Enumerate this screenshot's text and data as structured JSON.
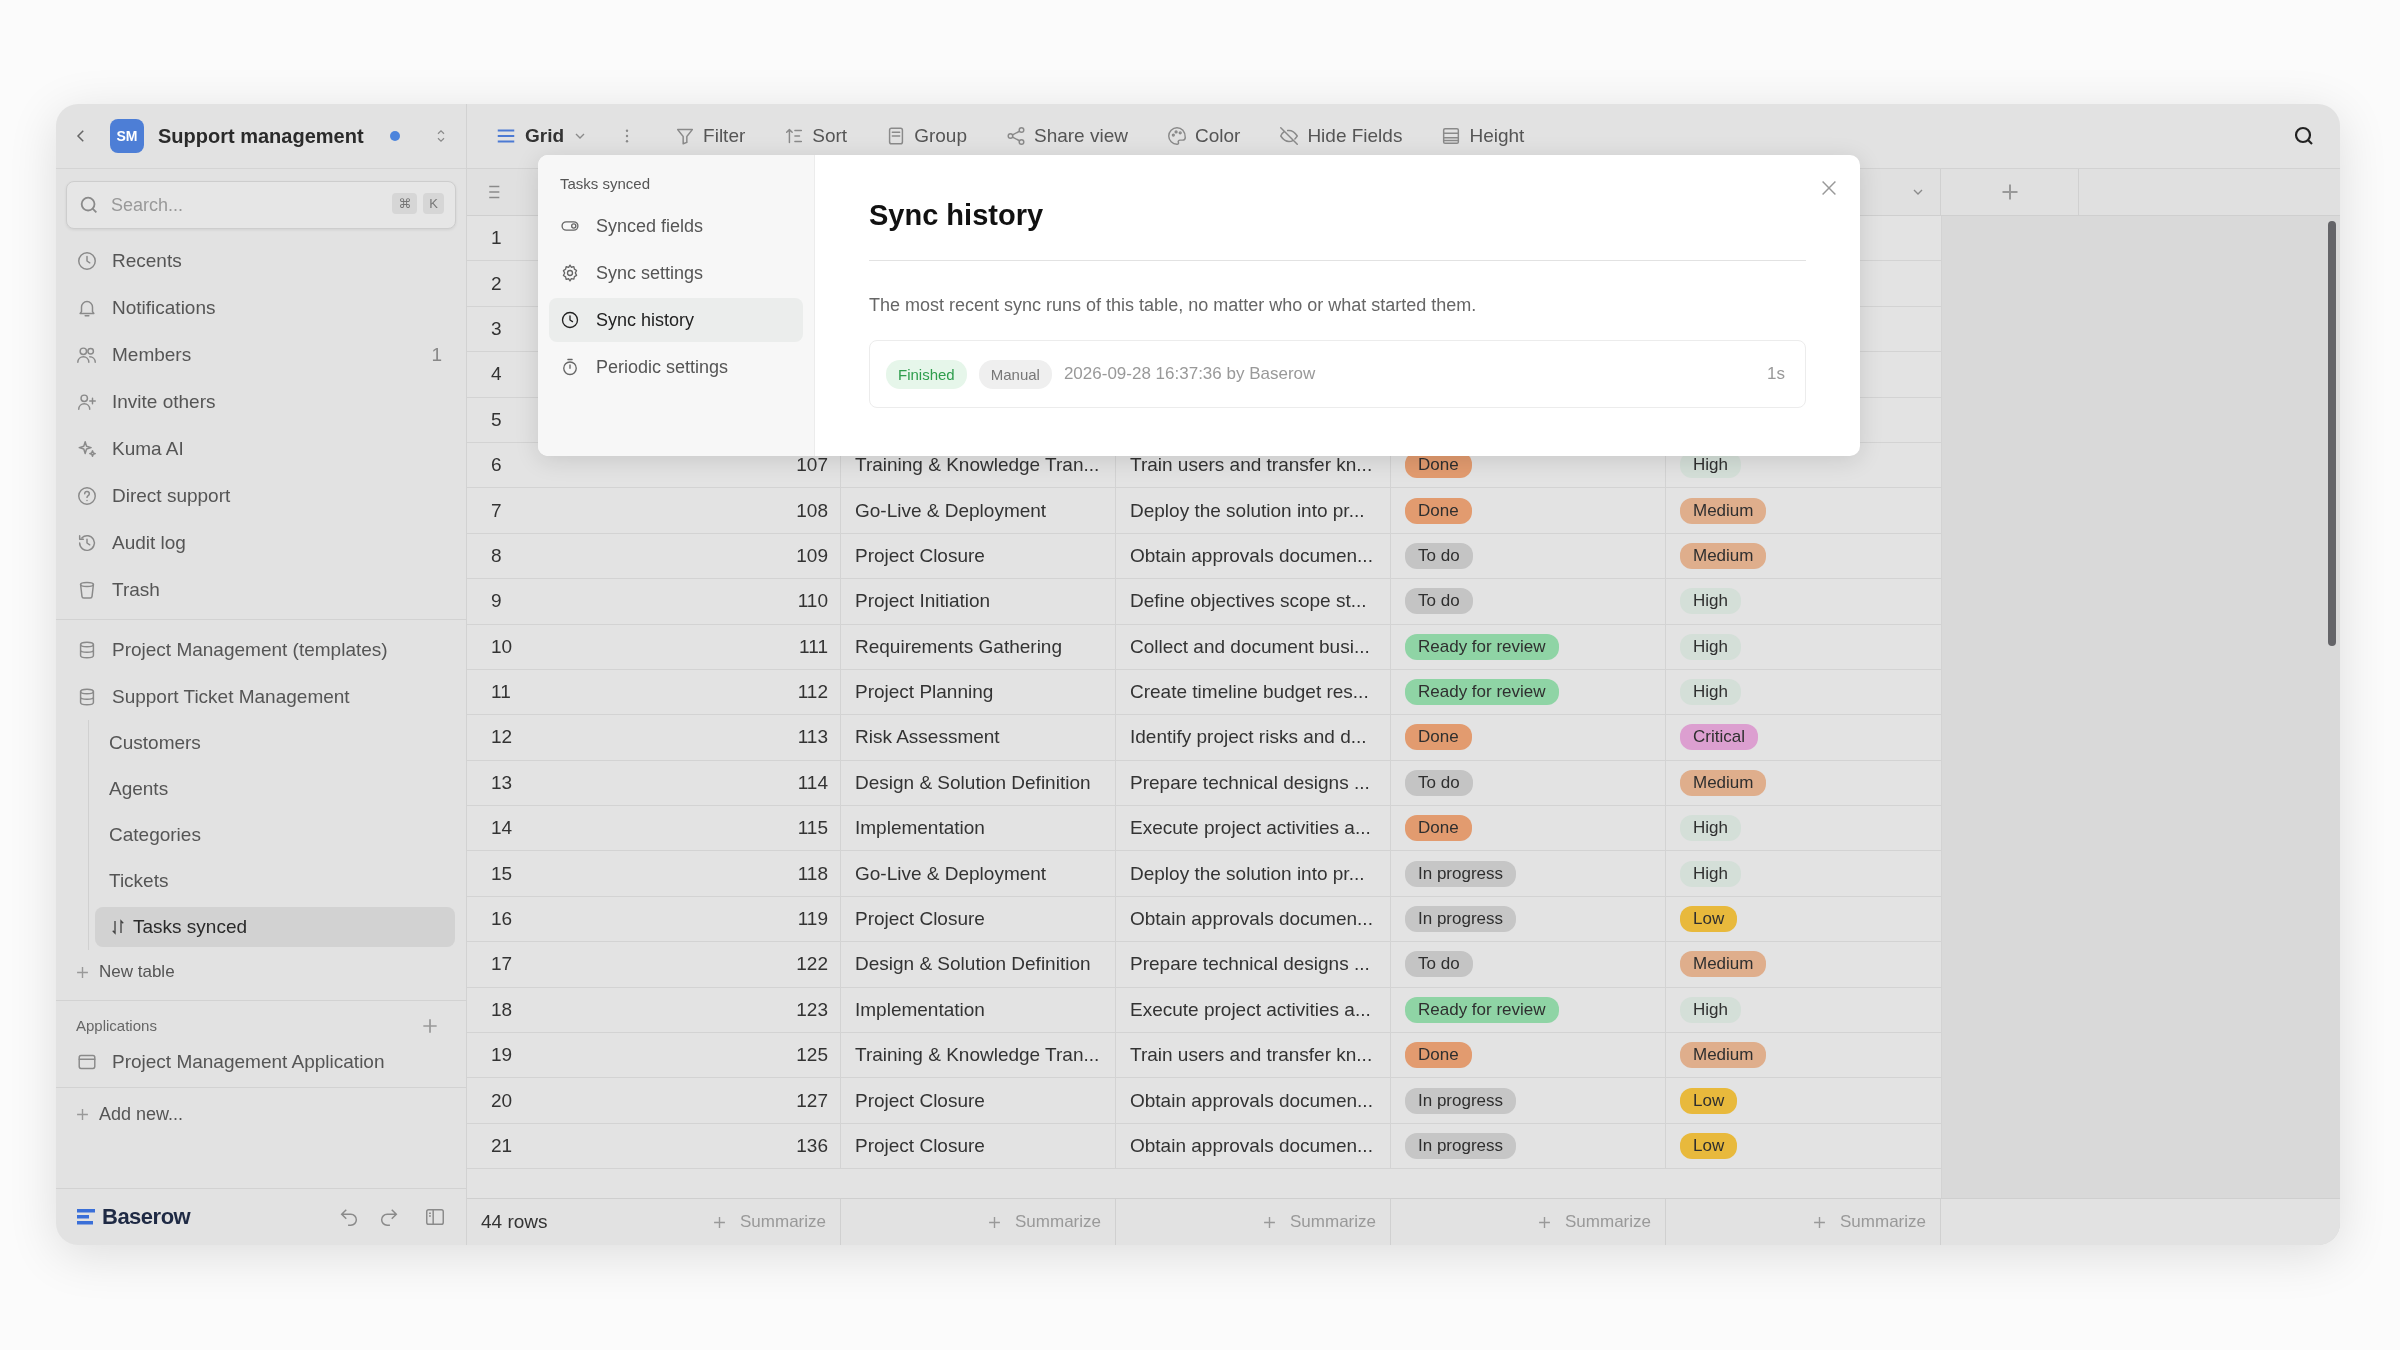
{
  "workspace": {
    "initials": "SM",
    "name": "Support management",
    "unread": true
  },
  "sidebar": {
    "search": {
      "placeholder": "Search...",
      "keys": [
        "⌘",
        "K"
      ]
    },
    "nav": [
      {
        "label": "Recents",
        "kind": "clock"
      },
      {
        "label": "Notifications",
        "kind": "bell"
      },
      {
        "label": "Members",
        "kind": "users",
        "count": "1"
      },
      {
        "label": "Invite others",
        "kind": "user-plus"
      },
      {
        "label": "Kuma AI",
        "kind": "sparkle"
      },
      {
        "label": "Direct support",
        "kind": "help"
      },
      {
        "label": "Audit log",
        "kind": "history"
      },
      {
        "label": "Trash",
        "kind": "trash"
      }
    ],
    "databases": [
      {
        "name": "Project Management (templates)"
      },
      {
        "name": "Support Ticket Management",
        "tables": [
          {
            "name": "Customers",
            "selected": false,
            "synced": false
          },
          {
            "name": "Agents",
            "selected": false,
            "synced": false
          },
          {
            "name": "Categories",
            "selected": false,
            "synced": false
          },
          {
            "name": "Tickets",
            "selected": false,
            "synced": false
          },
          {
            "name": "Tasks synced",
            "selected": true,
            "synced": true
          }
        ]
      }
    ],
    "new_table": "New table",
    "applications_heading": "Applications",
    "applications": [
      "Project Management Application"
    ],
    "add_new": "Add new...",
    "logo": "Baserow"
  },
  "toolbar": {
    "view": "Grid",
    "items": [
      {
        "label": "Filter",
        "kind": "filter"
      },
      {
        "label": "Sort",
        "kind": "sort"
      },
      {
        "label": "Group",
        "kind": "group"
      },
      {
        "label": "Share view",
        "kind": "share"
      },
      {
        "label": "Color",
        "kind": "palette"
      },
      {
        "label": "Hide Fields",
        "kind": "eye-off"
      },
      {
        "label": "Height",
        "kind": "rows"
      }
    ]
  },
  "grid": {
    "rows": [
      {
        "number": "1"
      },
      {
        "number": "2"
      },
      {
        "number": "3"
      },
      {
        "number": "4"
      },
      {
        "number": "5"
      },
      {
        "number": "6",
        "id": "107",
        "name": "Training & Knowledge Tran...",
        "description": "Train users and transfer kn...",
        "status": {
          "label": "Done",
          "color": "#e29b6f"
        },
        "priority": {
          "label": "High",
          "color": "#d4dfd8"
        }
      },
      {
        "number": "7",
        "id": "108",
        "name": "Go-Live & Deployment",
        "description": "Deploy the solution into pr...",
        "status": {
          "label": "Done",
          "color": "#e29b6f"
        },
        "priority": {
          "label": "Medium",
          "color": "#dfae8c"
        }
      },
      {
        "number": "8",
        "id": "109",
        "name": "Project Closure",
        "description": "Obtain approvals documen...",
        "status": {
          "label": "To do",
          "color": "#c4c4c4"
        },
        "priority": {
          "label": "Medium",
          "color": "#dfae8c"
        }
      },
      {
        "number": "9",
        "id": "110",
        "name": "Project Initiation",
        "description": "Define objectives scope st...",
        "status": {
          "label": "To do",
          "color": "#c4c4c4"
        },
        "priority": {
          "label": "High",
          "color": "#d4dfd8"
        }
      },
      {
        "number": "10",
        "id": "111",
        "name": "Requirements Gathering",
        "description": "Collect and document busi...",
        "status": {
          "label": "Ready for review",
          "color": "#8fd4a5"
        },
        "priority": {
          "label": "High",
          "color": "#d4dfd8"
        }
      },
      {
        "number": "11",
        "id": "112",
        "name": "Project Planning",
        "description": "Create timeline budget res...",
        "status": {
          "label": "Ready for review",
          "color": "#8fd4a5"
        },
        "priority": {
          "label": "High",
          "color": "#d4dfd8"
        }
      },
      {
        "number": "12",
        "id": "113",
        "name": "Risk Assessment",
        "description": "Identify project risks and d...",
        "status": {
          "label": "Done",
          "color": "#e29b6f"
        },
        "priority": {
          "label": "Critical",
          "color": "#dc9fd0"
        }
      },
      {
        "number": "13",
        "id": "114",
        "name": "Design & Solution Definition",
        "description": "Prepare technical designs ...",
        "status": {
          "label": "To do",
          "color": "#c4c4c4"
        },
        "priority": {
          "label": "Medium",
          "color": "#dfae8c"
        }
      },
      {
        "number": "14",
        "id": "115",
        "name": "Implementation",
        "description": "Execute project activities a...",
        "status": {
          "label": "Done",
          "color": "#e29b6f"
        },
        "priority": {
          "label": "High",
          "color": "#d4dfd8"
        }
      },
      {
        "number": "15",
        "id": "118",
        "name": "Go-Live & Deployment",
        "description": "Deploy the solution into pr...",
        "status": {
          "label": "In progress",
          "color": "#c6c6c6"
        },
        "priority": {
          "label": "High",
          "color": "#d4dfd8"
        }
      },
      {
        "number": "16",
        "id": "119",
        "name": "Project Closure",
        "description": "Obtain approvals documen...",
        "status": {
          "label": "In progress",
          "color": "#c6c6c6"
        },
        "priority": {
          "label": "Low",
          "color": "#e8b93c"
        }
      },
      {
        "number": "17",
        "id": "122",
        "name": "Design & Solution Definition",
        "description": "Prepare technical designs ...",
        "status": {
          "label": "To do",
          "color": "#c4c4c4"
        },
        "priority": {
          "label": "Medium",
          "color": "#dfae8c"
        }
      },
      {
        "number": "18",
        "id": "123",
        "name": "Implementation",
        "description": "Execute project activities a...",
        "status": {
          "label": "Ready for review",
          "color": "#8fd4a5"
        },
        "priority": {
          "label": "High",
          "color": "#d4dfd8"
        }
      },
      {
        "number": "19",
        "id": "125",
        "name": "Training & Knowledge Tran...",
        "description": "Train users and transfer kn...",
        "status": {
          "label": "Done",
          "color": "#e29b6f"
        },
        "priority": {
          "label": "Medium",
          "color": "#dfae8c"
        }
      },
      {
        "number": "20",
        "id": "127",
        "name": "Project Closure",
        "description": "Obtain approvals documen...",
        "status": {
          "label": "In progress",
          "color": "#c6c6c6"
        },
        "priority": {
          "label": "Low",
          "color": "#e8b93c"
        }
      },
      {
        "number": "21",
        "id": "136",
        "name": "Project Closure",
        "description": "Obtain approvals documen...",
        "status": {
          "label": "In progress",
          "color": "#c6c6c6"
        },
        "priority": {
          "label": "Low",
          "color": "#e8b93c"
        }
      }
    ],
    "row_count": "44 rows",
    "summarize": [
      "Summarize",
      "Summarize",
      "Summarize",
      "Summarize",
      "Summarize"
    ]
  },
  "modal": {
    "table": "Tasks synced",
    "nav": [
      {
        "label": "Synced fields",
        "kind": "toggle",
        "selected": false
      },
      {
        "label": "Sync settings",
        "kind": "gear",
        "selected": false
      },
      {
        "label": "Sync history",
        "kind": "clock",
        "selected": true
      },
      {
        "label": "Periodic settings",
        "kind": "timer",
        "selected": false
      }
    ],
    "title": "Sync history",
    "description": "The most recent sync runs of this table, no matter who or what started them.",
    "runs": [
      {
        "status": "Finished",
        "trigger": "Manual",
        "detail": "2026-09-28 16:37:36 by Baserow",
        "duration": "1s"
      }
    ]
  }
}
